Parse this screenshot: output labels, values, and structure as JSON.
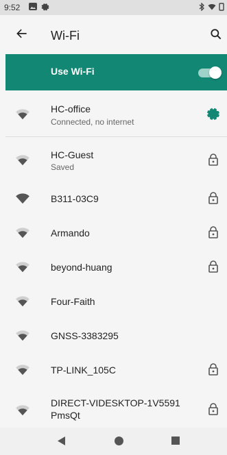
{
  "status_bar": {
    "time": "9:52"
  },
  "app_bar": {
    "title": "Wi-Fi"
  },
  "use_wifi": {
    "label": "Use Wi-Fi",
    "enabled": true
  },
  "colors": {
    "accent": "#118774",
    "icon": "#555555"
  },
  "networks": [
    {
      "name": "HC-office",
      "status": "Connected, no internet",
      "signal": 3,
      "secured": false,
      "action_icon": "gear-icon"
    },
    {
      "name": "HC-Guest",
      "status": "Saved",
      "signal": 3,
      "secured": true
    },
    {
      "name": "B311-03C9",
      "status": "",
      "signal": 4,
      "secured": true
    },
    {
      "name": "Armando",
      "status": "",
      "signal": 3,
      "secured": true
    },
    {
      "name": "beyond-huang",
      "status": "",
      "signal": 3,
      "secured": true
    },
    {
      "name": "Four-Faith",
      "status": "",
      "signal": 3,
      "secured": false
    },
    {
      "name": "GNSS-3383295",
      "status": "",
      "signal": 3,
      "secured": false
    },
    {
      "name": "TP-LINK_105C",
      "status": "",
      "signal": 3,
      "secured": true
    },
    {
      "name": "DIRECT-VIDESKTOP-1V5591",
      "name_line2": "PmsQt",
      "status": "",
      "signal": 3,
      "secured": true
    }
  ]
}
